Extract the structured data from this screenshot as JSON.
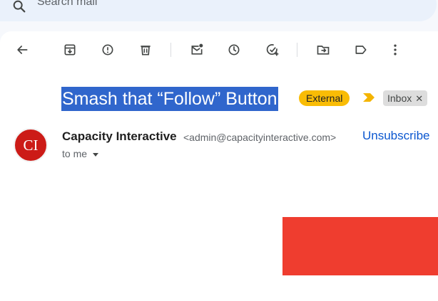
{
  "search": {
    "placeholder": "Search mail"
  },
  "toolbar": {
    "actions": [
      {
        "name": "back",
        "icon": "arrow-back-icon"
      },
      {
        "name": "archive",
        "icon": "archive-icon"
      },
      {
        "name": "report-spam",
        "icon": "report-icon"
      },
      {
        "name": "delete",
        "icon": "trash-icon"
      },
      {
        "name": "mark-unread",
        "icon": "mark-unread-icon"
      },
      {
        "name": "snooze",
        "icon": "clock-icon"
      },
      {
        "name": "add-to-tasks",
        "icon": "add-task-icon"
      },
      {
        "name": "move-to",
        "icon": "move-folder-icon"
      },
      {
        "name": "labels",
        "icon": "label-icon"
      },
      {
        "name": "more",
        "icon": "more-vert-icon"
      }
    ]
  },
  "email": {
    "subject": "Smash that “Follow” Button",
    "labels": {
      "external": "External",
      "inbox": "Inbox"
    },
    "sender": {
      "avatar_text": "CI",
      "name": "Capacity Interactive",
      "email": "<admin@capacityinteractive.com>"
    },
    "unsubscribe": "Unsubscribe",
    "recipient": "to me"
  },
  "colors": {
    "selection": "#3066cc",
    "external_chip": "#f9bc05",
    "avatar": "#cc1b17",
    "link": "#0b57d0",
    "banner": "#ef3d2f"
  }
}
